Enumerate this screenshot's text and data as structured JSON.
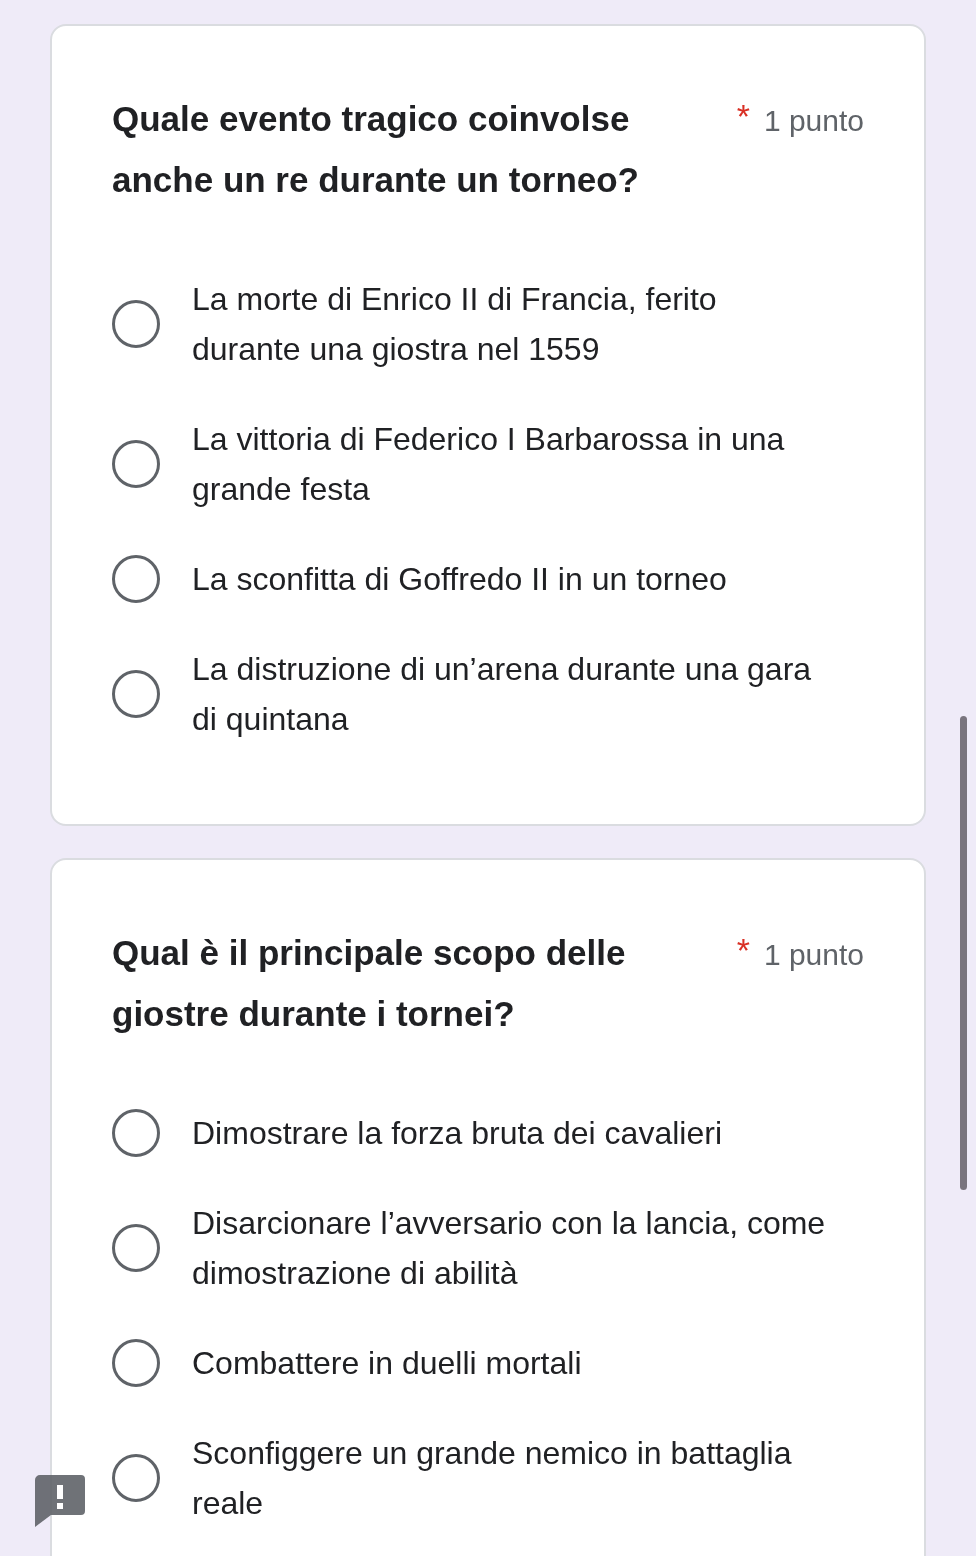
{
  "questions": [
    {
      "title": "Quale evento tragico coinvolse anche un re durante un torneo?",
      "required": true,
      "required_mark": "*",
      "points": "1 punto",
      "options": [
        {
          "label": "La morte di Enrico II di Francia, ferito durante una giostra nel 1559",
          "selected": false
        },
        {
          "label": "La vittoria di Federico I Barbarossa in una grande festa",
          "selected": false
        },
        {
          "label": "La sconfitta di Goffredo II in un torneo",
          "selected": false
        },
        {
          "label": "La distruzione di un’arena durante una gara di quintana",
          "selected": false
        }
      ]
    },
    {
      "title": "Qual è il principale scopo delle giostre durante i tornei?",
      "required": true,
      "required_mark": "*",
      "points": "1 punto",
      "options": [
        {
          "label": "Dimostrare la forza bruta dei cavalieri",
          "selected": false
        },
        {
          "label": "Disarcionare l’avversario con la lancia, come dimostrazione di abilità",
          "selected": false
        },
        {
          "label": "Combattere in duelli mortali",
          "selected": false
        },
        {
          "label": "Sconfiggere un grande nemico in battaglia reale",
          "selected": false
        }
      ]
    }
  ]
}
